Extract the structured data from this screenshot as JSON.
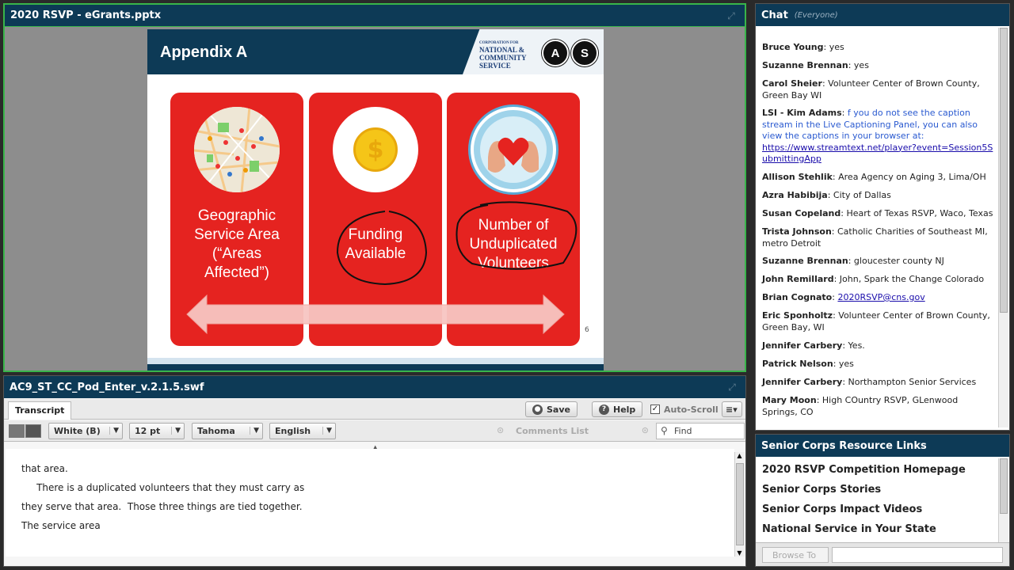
{
  "share_pod": {
    "title": "2020 RSVP - eGrants.pptx",
    "slide": {
      "title": "Appendix A",
      "logo_text": [
        "CORPORATION FOR",
        "NATIONAL &",
        "COMMUNITY",
        "SERVICE"
      ],
      "seal_a": "A",
      "seal_s": "S",
      "card1_text": [
        "Geographic",
        "Service Area",
        "(“Areas",
        "Affected”)"
      ],
      "card2_text": [
        "Funding",
        "Available"
      ],
      "card3_text": [
        "Number of",
        "Unduplicated",
        "Volunteers"
      ],
      "coin_symbol": "$",
      "page_number": "6"
    },
    "colors": {
      "card_red": "#e52320",
      "header_navy": "#0d3a56",
      "presenter_border": "#39b54a"
    }
  },
  "caption_pod": {
    "title": "AC9_ST_CC_Pod_Enter_v.2.1.5.swf",
    "tab_label": "Transcript",
    "save_label": "Save",
    "help_label": "Help",
    "autoscroll_label": "Auto-Scroll",
    "color_value": "White (B)",
    "size_value": "12 pt",
    "font_value": "Tahoma",
    "language_value": "English",
    "comments_label": "Comments List",
    "find_placeholder": "Find",
    "lines": [
      "that area.",
      "     There is a duplicated volunteers that they must carry as",
      "they serve that area.  Those three things are tied together.",
      "The service area"
    ]
  },
  "chat_pod": {
    "title": "Chat",
    "audience": "(Everyone)",
    "messages": [
      {
        "name": "Bruce Young",
        "text": "yes"
      },
      {
        "name": "Suzanne  Brennan",
        "text": "yes"
      },
      {
        "name": "Carol Sheier",
        "text": "Volunteer Center of Brown County, Green Bay WI"
      },
      {
        "name": "LSI - Kim Adams",
        "text": "f you do not see the caption stream in the Live Captioning Panel, you can also view the captions in your browser at:",
        "link": "https://www.streamtext.net/player?event=Session5SubmittingApp"
      },
      {
        "name": "Allison Stehlik",
        "text": "Area Agency on Aging 3, Lima/OH"
      },
      {
        "name": "Azra Habibija",
        "text": "City of Dallas"
      },
      {
        "name": "Susan Copeland",
        "text": "Heart of Texas RSVP, Waco, Texas"
      },
      {
        "name": "Trista Johnson",
        "text": "Catholic Charities of Southeast MI, metro Detroit"
      },
      {
        "name": "Suzanne  Brennan",
        "text": "gloucester county NJ"
      },
      {
        "name": "John Remillard",
        "text": "John, Spark the Change Colorado"
      },
      {
        "name": "Brian Cognato",
        "text": "",
        "link": "2020RSVP@cns.gov"
      },
      {
        "name": "Eric Sponholtz",
        "text": "Volunteer Center of Brown County, Green Bay, WI"
      },
      {
        "name": "Jennifer Carbery",
        "text": "Yes."
      },
      {
        "name": "Patrick Nelson",
        "text": "yes"
      },
      {
        "name": "Jennifer Carbery",
        "text": "Northampton Senior Services"
      },
      {
        "name": "Mary Moon",
        "text": "High COuntry RSVP, GLenwood Springs, CO"
      }
    ]
  },
  "links_pod": {
    "title": "Senior Corps Resource Links",
    "items": [
      "2020 RSVP Competition Homepage",
      "Senior Corps Stories",
      "Senior Corps Impact Videos",
      "National Service in Your State"
    ],
    "browse_label": "Browse To"
  }
}
